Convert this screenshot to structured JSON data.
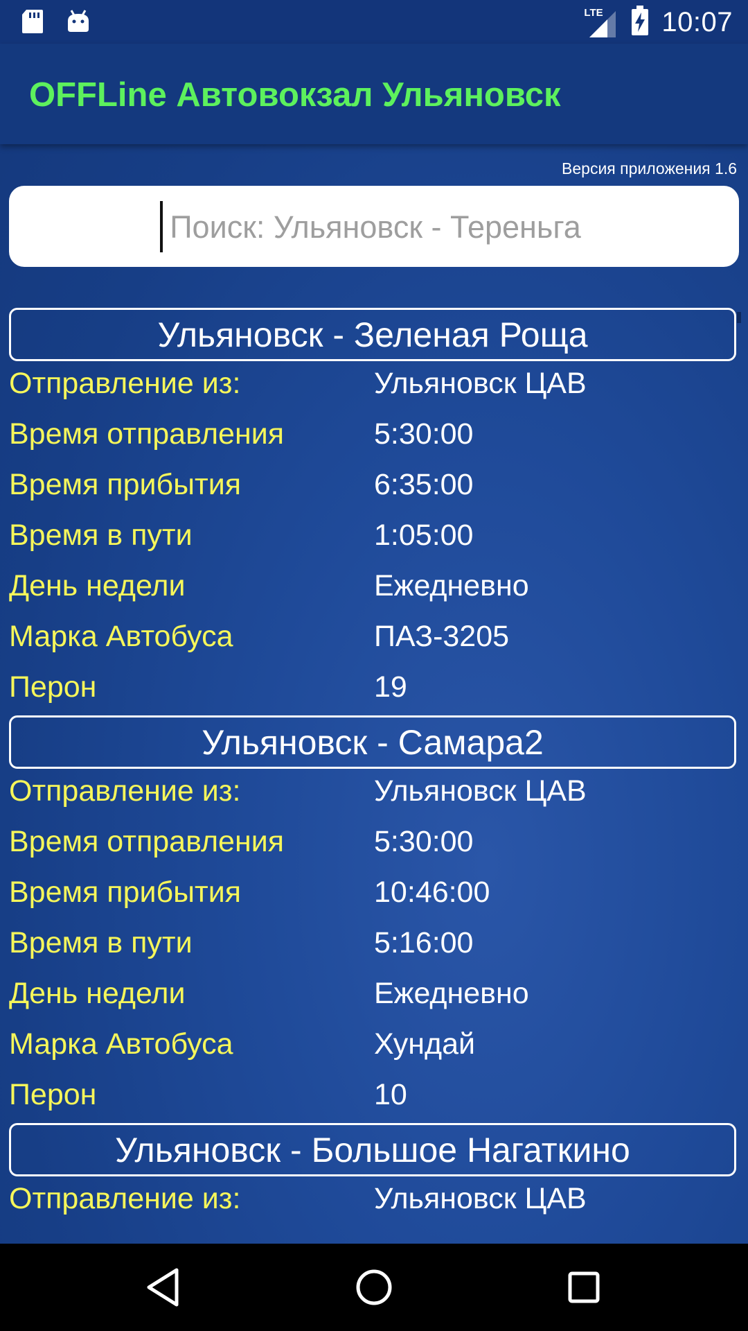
{
  "status_bar": {
    "time": "10:07",
    "network": "LTE",
    "left_icons": [
      "sd-card-icon",
      "android-icon"
    ]
  },
  "app_bar": {
    "title": "OFFLine Автовокзал Ульяновск"
  },
  "version": "Версия приложения 1.6",
  "search": {
    "placeholder": "Поиск: Ульяновск - Тереньга",
    "value": ""
  },
  "labels": {
    "departure_from": "Отправление из:",
    "departure_time": "Время отправления",
    "arrival_time": "Время прибытия",
    "travel_time": "Время в пути",
    "weekday": "День недели",
    "bus_model": "Марка Автобуса",
    "platform": "Перон"
  },
  "routes": [
    {
      "title": "Ульяновск - Зеленая Роща",
      "departure_from": "Ульяновск ЦАВ",
      "departure_time": "5:30:00",
      "arrival_time": "6:35:00",
      "travel_time": "1:05:00",
      "weekday": "Ежедневно",
      "bus_model": "ПАЗ-3205",
      "platform": "19"
    },
    {
      "title": "Ульяновск - Самара2",
      "departure_from": "Ульяновск ЦАВ",
      "departure_time": "5:30:00",
      "arrival_time": "10:46:00",
      "travel_time": "5:16:00",
      "weekday": "Ежедневно",
      "bus_model": "Хундай",
      "platform": "10"
    },
    {
      "title": "Ульяновск - Большое Нагаткино",
      "departure_from": "Ульяновск ЦАВ"
    }
  ],
  "nav": [
    "back-icon",
    "home-icon",
    "recents-icon"
  ],
  "colors": {
    "title_green": "#5df15d",
    "label_yellow": "#f6f65a",
    "background_blue": "#1f4a99",
    "app_bar_blue": "#14397e"
  }
}
